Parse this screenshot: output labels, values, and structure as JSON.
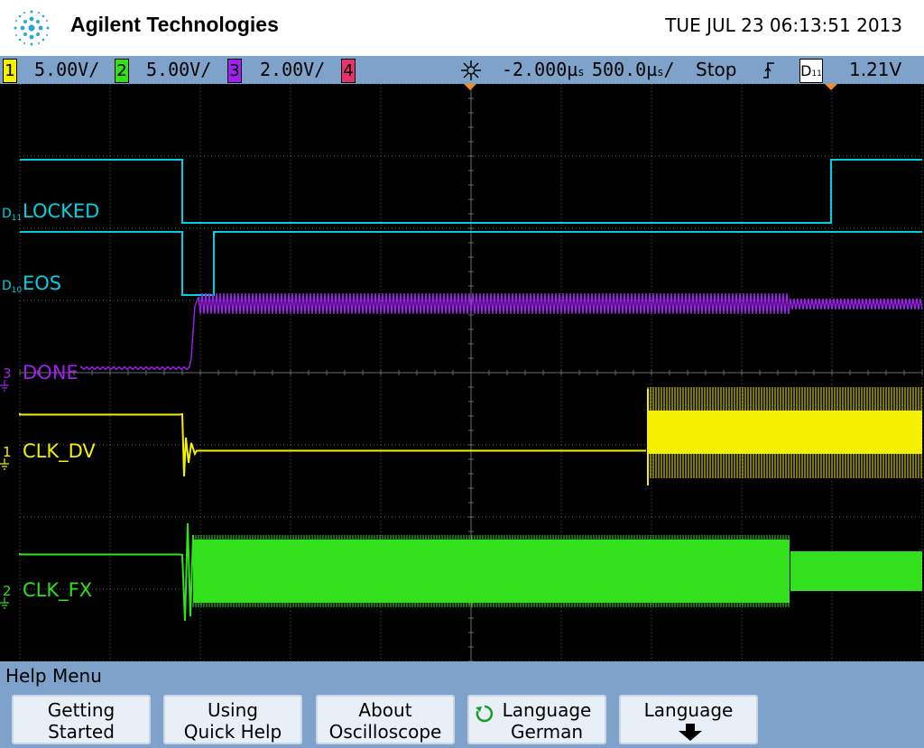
{
  "header": {
    "brand": "Agilent Technologies",
    "datetime": "TUE JUL 23 06:13:51 2013"
  },
  "status_bar": {
    "channels": [
      {
        "num": "1",
        "scale": "5.00V/",
        "color": "#f4f000"
      },
      {
        "num": "2",
        "scale": "5.00V/",
        "color": "#33e01c"
      },
      {
        "num": "3",
        "scale": "2.00V/",
        "color": "#a020f0"
      },
      {
        "num": "4",
        "scale": "",
        "color": "#e8306a"
      }
    ],
    "delay": "-2.000µ",
    "delay_unit": "s",
    "timebase": "500.0µ",
    "timebase_unit": "/",
    "run_state": "Stop",
    "trigger_source": "D",
    "trigger_source_sub": "11",
    "trigger_level": "1.21V"
  },
  "traces": {
    "locked": {
      "label": "LOCKED",
      "marker": "D",
      "marker_sub": "11",
      "color": "#00d0e0"
    },
    "eos": {
      "label": "EOS",
      "marker": "D",
      "marker_sub": "10",
      "color": "#00d0e0"
    },
    "done": {
      "label": "DONE",
      "marker": "3",
      "color": "#a020f0"
    },
    "clk_dv": {
      "label": "CLK_DV",
      "marker": "1",
      "color": "#f4f000"
    },
    "clk_fx": {
      "label": "CLK_FX",
      "marker": "2",
      "color": "#33e01c"
    }
  },
  "help_menu": {
    "title": "Help Menu",
    "softkeys": [
      {
        "line1": "Getting",
        "line2": "Started"
      },
      {
        "line1": "Using",
        "line2": "Quick Help"
      },
      {
        "line1": "About",
        "line2": "Oscilloscope"
      },
      {
        "line1": "Language",
        "line2": "German"
      },
      {
        "line1": "Language",
        "line2": ""
      }
    ]
  }
}
